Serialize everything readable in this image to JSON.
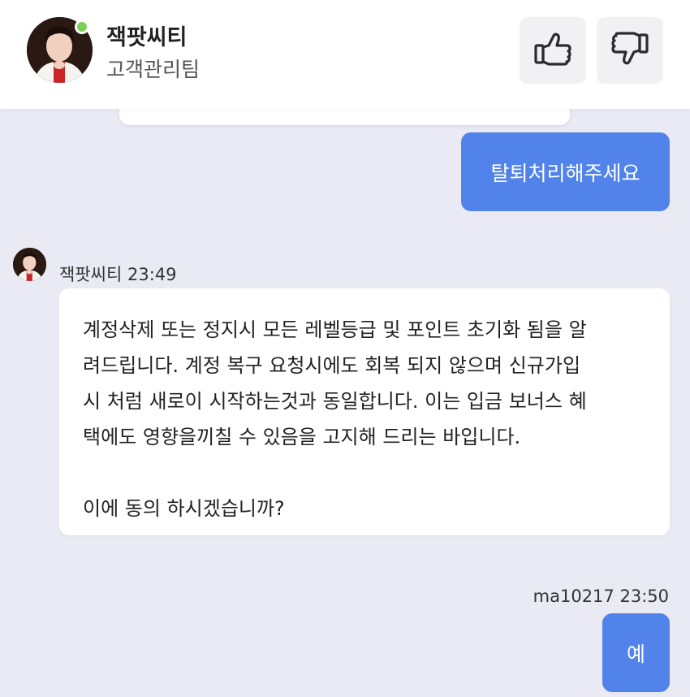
{
  "header": {
    "agent_name": "잭팟씨티",
    "agent_team": "고객관리팀",
    "status_color": "#7bcf5a",
    "thumb_up_icon": "thumbs-up-icon",
    "thumb_down_icon": "thumbs-down-icon"
  },
  "messages": {
    "user_1": {
      "text": "탈퇴처리해주세요"
    },
    "agent_1": {
      "sender": "잭팟씨티",
      "time": "23:49",
      "lines": [
        "계정삭제 또는 정지시 모든 레벨등급 및 포인트 초기화 됨을 알",
        "려드립니다. 계정 복구 요청시에도 회복 되지 않으며 신규가입",
        "시 처럼 새로이 시작하는것과 동일합니다. 이는 입금 보너스 혜",
        "택에도 영향을끼칠 수 있음을 고지해 드리는 바입니다."
      ],
      "question": "이에 동의 하시겠습니까?"
    },
    "user_2": {
      "sender": "ma10217",
      "time": "23:50",
      "text": "예"
    }
  },
  "colors": {
    "user_bubble": "#5283ea",
    "background": "#e9eaf3"
  }
}
